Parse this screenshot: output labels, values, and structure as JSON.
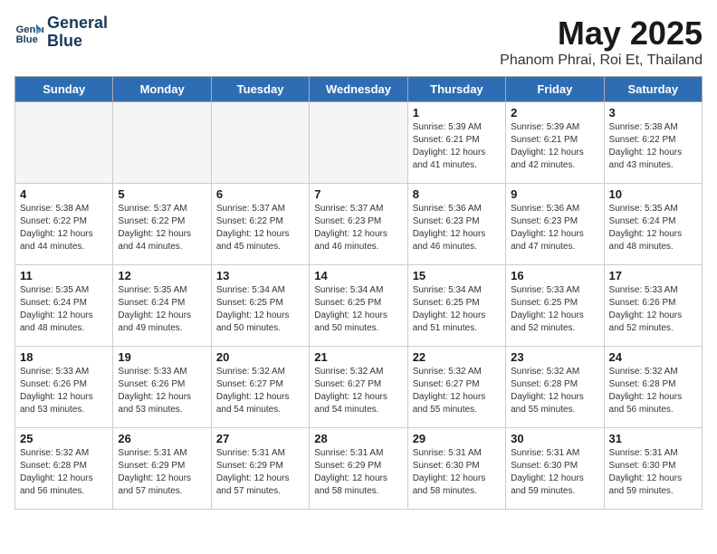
{
  "header": {
    "logo_line1": "General",
    "logo_line2": "Blue",
    "month_title": "May 2025",
    "subtitle": "Phanom Phrai, Roi Et, Thailand"
  },
  "days_of_week": [
    "Sunday",
    "Monday",
    "Tuesday",
    "Wednesday",
    "Thursday",
    "Friday",
    "Saturday"
  ],
  "weeks": [
    [
      {
        "day": "",
        "empty": true
      },
      {
        "day": "",
        "empty": true
      },
      {
        "day": "",
        "empty": true
      },
      {
        "day": "",
        "empty": true
      },
      {
        "day": "1",
        "sunrise": "5:39 AM",
        "sunset": "6:21 PM",
        "daylight": "12 hours and 41 minutes."
      },
      {
        "day": "2",
        "sunrise": "5:39 AM",
        "sunset": "6:21 PM",
        "daylight": "12 hours and 42 minutes."
      },
      {
        "day": "3",
        "sunrise": "5:38 AM",
        "sunset": "6:22 PM",
        "daylight": "12 hours and 43 minutes."
      }
    ],
    [
      {
        "day": "4",
        "sunrise": "5:38 AM",
        "sunset": "6:22 PM",
        "daylight": "12 hours and 44 minutes."
      },
      {
        "day": "5",
        "sunrise": "5:37 AM",
        "sunset": "6:22 PM",
        "daylight": "12 hours and 44 minutes."
      },
      {
        "day": "6",
        "sunrise": "5:37 AM",
        "sunset": "6:22 PM",
        "daylight": "12 hours and 45 minutes."
      },
      {
        "day": "7",
        "sunrise": "5:37 AM",
        "sunset": "6:23 PM",
        "daylight": "12 hours and 46 minutes."
      },
      {
        "day": "8",
        "sunrise": "5:36 AM",
        "sunset": "6:23 PM",
        "daylight": "12 hours and 46 minutes."
      },
      {
        "day": "9",
        "sunrise": "5:36 AM",
        "sunset": "6:23 PM",
        "daylight": "12 hours and 47 minutes."
      },
      {
        "day": "10",
        "sunrise": "5:35 AM",
        "sunset": "6:24 PM",
        "daylight": "12 hours and 48 minutes."
      }
    ],
    [
      {
        "day": "11",
        "sunrise": "5:35 AM",
        "sunset": "6:24 PM",
        "daylight": "12 hours and 48 minutes."
      },
      {
        "day": "12",
        "sunrise": "5:35 AM",
        "sunset": "6:24 PM",
        "daylight": "12 hours and 49 minutes."
      },
      {
        "day": "13",
        "sunrise": "5:34 AM",
        "sunset": "6:25 PM",
        "daylight": "12 hours and 50 minutes."
      },
      {
        "day": "14",
        "sunrise": "5:34 AM",
        "sunset": "6:25 PM",
        "daylight": "12 hours and 50 minutes."
      },
      {
        "day": "15",
        "sunrise": "5:34 AM",
        "sunset": "6:25 PM",
        "daylight": "12 hours and 51 minutes."
      },
      {
        "day": "16",
        "sunrise": "5:33 AM",
        "sunset": "6:25 PM",
        "daylight": "12 hours and 52 minutes."
      },
      {
        "day": "17",
        "sunrise": "5:33 AM",
        "sunset": "6:26 PM",
        "daylight": "12 hours and 52 minutes."
      }
    ],
    [
      {
        "day": "18",
        "sunrise": "5:33 AM",
        "sunset": "6:26 PM",
        "daylight": "12 hours and 53 minutes."
      },
      {
        "day": "19",
        "sunrise": "5:33 AM",
        "sunset": "6:26 PM",
        "daylight": "12 hours and 53 minutes."
      },
      {
        "day": "20",
        "sunrise": "5:32 AM",
        "sunset": "6:27 PM",
        "daylight": "12 hours and 54 minutes."
      },
      {
        "day": "21",
        "sunrise": "5:32 AM",
        "sunset": "6:27 PM",
        "daylight": "12 hours and 54 minutes."
      },
      {
        "day": "22",
        "sunrise": "5:32 AM",
        "sunset": "6:27 PM",
        "daylight": "12 hours and 55 minutes."
      },
      {
        "day": "23",
        "sunrise": "5:32 AM",
        "sunset": "6:28 PM",
        "daylight": "12 hours and 55 minutes."
      },
      {
        "day": "24",
        "sunrise": "5:32 AM",
        "sunset": "6:28 PM",
        "daylight": "12 hours and 56 minutes."
      }
    ],
    [
      {
        "day": "25",
        "sunrise": "5:32 AM",
        "sunset": "6:28 PM",
        "daylight": "12 hours and 56 minutes."
      },
      {
        "day": "26",
        "sunrise": "5:31 AM",
        "sunset": "6:29 PM",
        "daylight": "12 hours and 57 minutes."
      },
      {
        "day": "27",
        "sunrise": "5:31 AM",
        "sunset": "6:29 PM",
        "daylight": "12 hours and 57 minutes."
      },
      {
        "day": "28",
        "sunrise": "5:31 AM",
        "sunset": "6:29 PM",
        "daylight": "12 hours and 58 minutes."
      },
      {
        "day": "29",
        "sunrise": "5:31 AM",
        "sunset": "6:30 PM",
        "daylight": "12 hours and 58 minutes."
      },
      {
        "day": "30",
        "sunrise": "5:31 AM",
        "sunset": "6:30 PM",
        "daylight": "12 hours and 59 minutes."
      },
      {
        "day": "31",
        "sunrise": "5:31 AM",
        "sunset": "6:30 PM",
        "daylight": "12 hours and 59 minutes."
      }
    ]
  ]
}
